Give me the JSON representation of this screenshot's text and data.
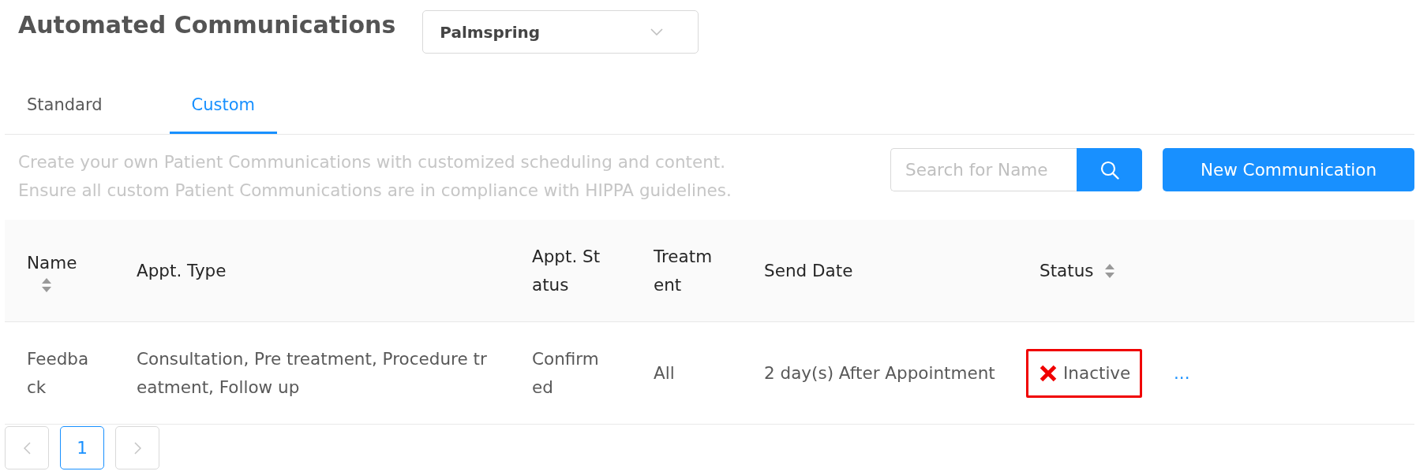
{
  "page": {
    "title": "Automated Communications"
  },
  "location_select": {
    "value": "Palmspring"
  },
  "tabs": [
    {
      "label": "Standard",
      "selected": false
    },
    {
      "label": "Custom",
      "selected": true
    }
  ],
  "description": [
    "Create your own Patient Communications with customized scheduling and content.",
    "Ensure all custom Patient Communications are in compliance with HIPPA guidelines."
  ],
  "search": {
    "placeholder": "Search for Name"
  },
  "new_button": {
    "label": "New Communication"
  },
  "table": {
    "columns": [
      {
        "label": "Name",
        "sortable": true
      },
      {
        "label": "Appt. Type",
        "sortable": false
      },
      {
        "label": "Appt. Status",
        "sortable": false
      },
      {
        "label": "Treatment",
        "sortable": false
      },
      {
        "label": "Send Date",
        "sortable": false
      },
      {
        "label": "Status",
        "sortable": true
      }
    ],
    "rows": [
      {
        "name": "Feedback",
        "appt_type": "Consultation, Pre treatment, Procedure treatment, Follow up",
        "appt_status": "Confirmed",
        "treatment": "All",
        "send_date": "2 day(s) After Appointment",
        "status": {
          "label": "Inactive",
          "active": false,
          "highlighted": true
        },
        "action": "..."
      }
    ]
  },
  "pagination": {
    "previous": {
      "disabled": true
    },
    "pages": [
      {
        "label": "1",
        "selected": true
      }
    ],
    "next": {
      "disabled": true
    }
  }
}
